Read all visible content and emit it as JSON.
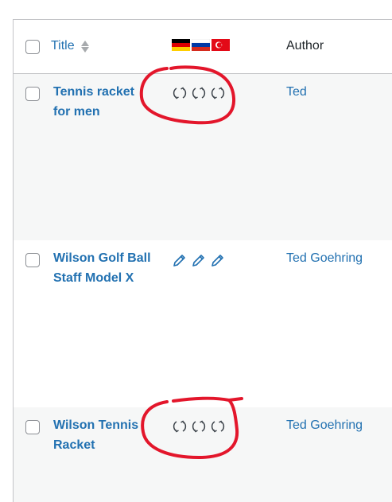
{
  "table": {
    "header": {
      "title_label": "Title",
      "author_label": "Author",
      "flags": [
        "flag-germany-icon",
        "flag-russia-icon",
        "flag-turkey-icon"
      ]
    },
    "rows": [
      {
        "title": "Tennis racket for men",
        "title_lines": [
          "Tennis racket",
          "for men"
        ],
        "author": "Ted",
        "translation_icons": [
          "sync-icon",
          "sync-icon",
          "sync-icon"
        ]
      },
      {
        "title": "Wilson Golf Ball Staff Model X",
        "title_lines": [
          "Wilson Golf Ball",
          "Staff Model X"
        ],
        "author": "Ted Goehring",
        "translation_icons": [
          "pencil-icon",
          "pencil-icon",
          "pencil-icon"
        ]
      },
      {
        "title": "Wilson Tennis Racket",
        "title_lines": [
          "Wilson Tennis",
          "Racket"
        ],
        "author": "Ted Goehring",
        "translation_icons": [
          "sync-icon",
          "sync-icon",
          "sync-icon"
        ]
      }
    ]
  },
  "colors": {
    "link": "#2271b1",
    "annotation": "#e3162b",
    "row_alt_bg": "#f6f7f7",
    "border": "#c3c4c7"
  }
}
